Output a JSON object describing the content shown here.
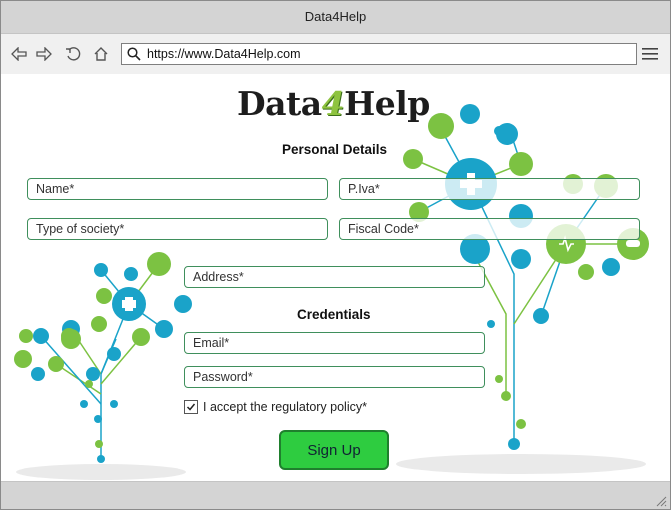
{
  "window": {
    "title": "Data4Help"
  },
  "browser": {
    "url": "https://www.Data4Help.com"
  },
  "logo": {
    "part1": "Data",
    "part2": "4",
    "part3": "Help"
  },
  "personal": {
    "title": "Personal Details",
    "name_placeholder": "Name*",
    "piva_placeholder": "P.Iva*",
    "society_placeholder": "Type of society*",
    "fiscal_placeholder": "Fiscal Code*",
    "address_placeholder": "Address*"
  },
  "credentials": {
    "title": "Credentials",
    "email_placeholder": "Email*",
    "password_placeholder": "Password*"
  },
  "policy": {
    "label": "I accept the regulatory policy*",
    "checked": true
  },
  "signup": {
    "label": "Sign Up"
  },
  "colors": {
    "accent_green": "#2ecc40",
    "field_border": "#3f8f5c",
    "teal": "#1aa3c9",
    "lime": "#7cc242"
  }
}
